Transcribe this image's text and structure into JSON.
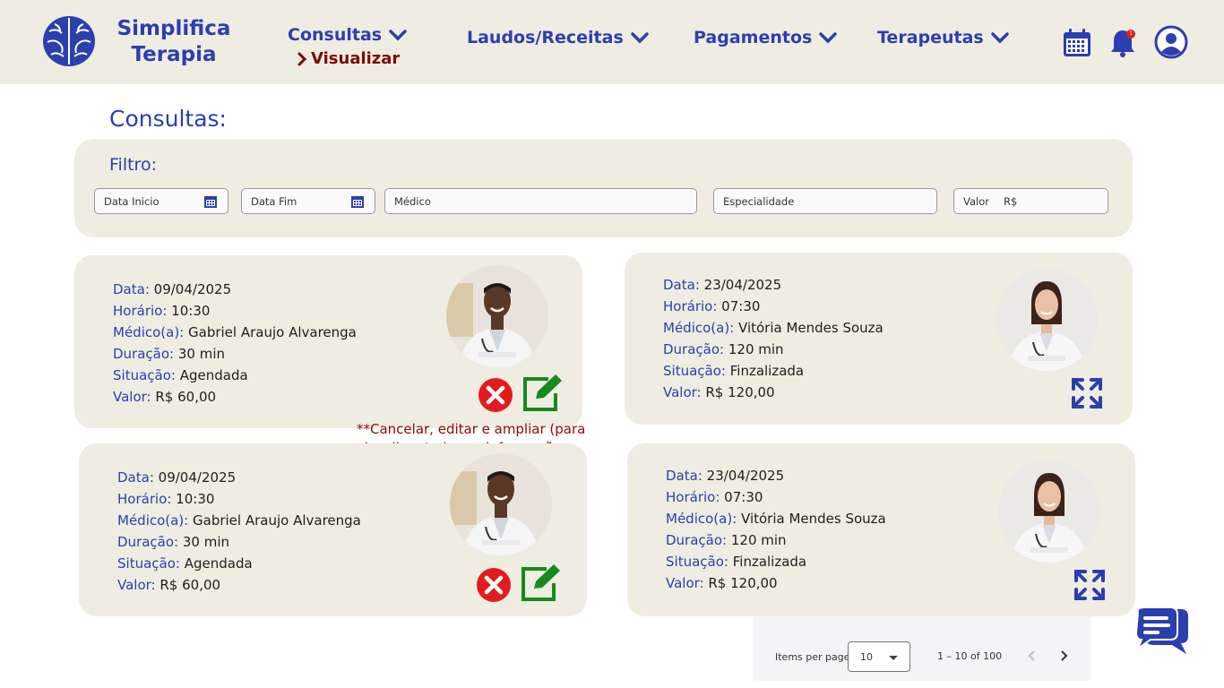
{
  "header": {
    "brand_line1": "Simplifica",
    "brand_line2": "Terapia",
    "nav": [
      {
        "label": "Consultas"
      },
      {
        "label": "Laudos/Receitas"
      },
      {
        "label": "Pagamentos"
      },
      {
        "label": "Terapeutas"
      }
    ],
    "submenu_active": "Visualizar",
    "notification_count": "1",
    "icons": [
      "brain-logo-icon",
      "calendar-icon",
      "bell-icon",
      "user-account-icon"
    ]
  },
  "page": {
    "title": "Consultas:"
  },
  "filter": {
    "label": "Filtro:",
    "data_inicio": "Data Inicio",
    "data_fim": "Data Fim",
    "medico": "Médico",
    "especialidade": "Especialidade",
    "valor": "Valor",
    "valor_prefix": "R$"
  },
  "labels": {
    "data": "Data:",
    "horario": "Horário:",
    "medico": "Médico(a):",
    "duracao": "Duração:",
    "situacao": "Situação:",
    "valor": "Valor:"
  },
  "cards": [
    {
      "data": "09/04/2025",
      "horario": "10:30",
      "medico": "Gabriel Araujo Alvarenga",
      "duracao": "30 min",
      "situacao": "Agendada",
      "valor": "R$ 60,00",
      "actions": [
        "cancel-icon",
        "edit-icon"
      ]
    },
    {
      "data": "23/04/2025",
      "horario": "07:30",
      "medico": "Vitória Mendes Souza",
      "duracao": "120 min",
      "situacao": "Finzalizada",
      "valor": "R$ 120,00",
      "actions": [
        "expand-icon"
      ]
    },
    {
      "data": "09/04/2025",
      "horario": "10:30",
      "medico": "Gabriel Araujo Alvarenga",
      "duracao": "30 min",
      "situacao": "Agendada",
      "valor": "R$ 60,00",
      "actions": [
        "cancel-icon",
        "edit-icon"
      ]
    },
    {
      "data": "23/04/2025",
      "horario": "07:30",
      "medico": "Vitória Mendes Souza",
      "duracao": "120 min",
      "situacao": "Finzalizada",
      "valor": "R$ 120,00",
      "actions": [
        "expand-icon"
      ]
    }
  ],
  "note": "**Cancelar, editar e ampliar (para visualizar todas as informações",
  "paginator": {
    "items_per_page_label": "Items per page:",
    "items_per_page_value": "10",
    "range": "1 – 10 of 100"
  },
  "colors": {
    "primary": "#2b3fae",
    "header_bg": "#efece2",
    "card_bg": "#efece2",
    "accent_red": "#7a0b0b",
    "cancel_red": "#e21c1c",
    "edit_green": "#168a1c"
  }
}
